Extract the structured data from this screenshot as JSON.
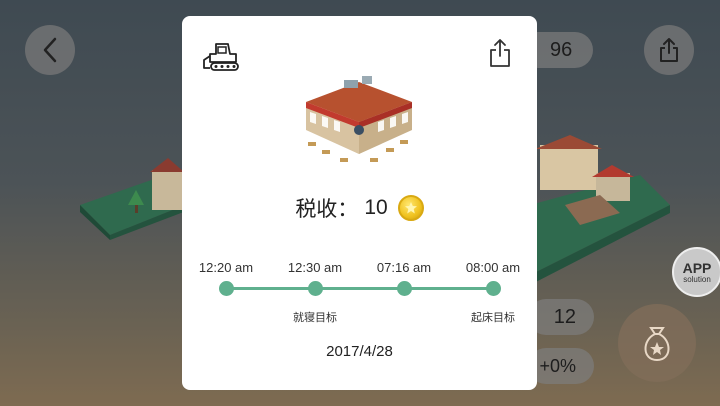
{
  "background": {
    "gem_count": "96",
    "people_count": "12",
    "bonus_text": "+0%",
    "app_badge_line1": "APP",
    "app_badge_line2": "solution"
  },
  "modal": {
    "tax_label": "税收：",
    "tax_value": "10",
    "timeline": [
      {
        "time": "12:20 am",
        "caption": ""
      },
      {
        "time": "12:30 am",
        "caption": "就寝目标"
      },
      {
        "time": "07:16 am",
        "caption": ""
      },
      {
        "time": "08:00 am",
        "caption": "起床目标"
      }
    ],
    "date": "2017/4/28",
    "accent_color": "#5fb08e"
  },
  "icons": {
    "back": "chevron-left-icon",
    "share": "share-icon",
    "bulldozer": "bulldozer-icon",
    "coin": "coin-icon",
    "money_bag": "money-bag-icon"
  }
}
